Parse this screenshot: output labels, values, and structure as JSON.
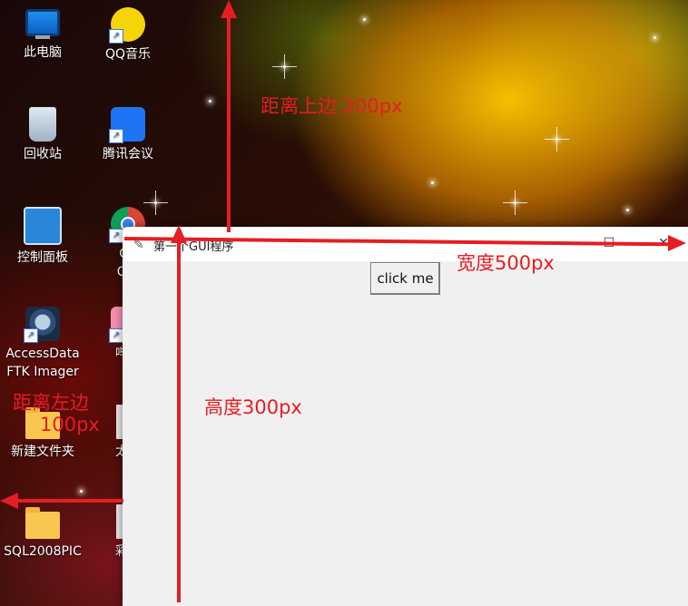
{
  "desktop": {
    "icons": [
      {
        "label": "此电脑",
        "icon": "computer-icon"
      },
      {
        "label": "QQ音乐",
        "icon": "qq-music-icon"
      },
      {
        "label": "回收站",
        "icon": "recycle-bin-icon"
      },
      {
        "label": "腾讯会议",
        "icon": "tencent-meeting-icon"
      },
      {
        "label": "控制面板",
        "icon": "control-panel-icon"
      },
      {
        "label": "Go",
        "label2": "Chr",
        "icon": "chrome-icon"
      },
      {
        "label": "AccessData",
        "label2": "FTK Imager",
        "icon": "ftk-imager-icon"
      },
      {
        "label": "哔哩",
        "icon": "bilibili-icon"
      },
      {
        "label": "新建文件夹",
        "icon": "folder-icon"
      },
      {
        "label": "太阳",
        "icon": "file-icon"
      },
      {
        "label": "SQL2008PIC",
        "icon": "folder-icon"
      },
      {
        "label": "彩旗",
        "icon": "file-icon"
      }
    ]
  },
  "window": {
    "title": "第一个GUI程序",
    "minimize": "—",
    "maximize": "☐",
    "close": "✕",
    "button_label": "click me"
  },
  "annotations": {
    "top": "距离上边 200px",
    "width": "宽度500px",
    "height": "高度300px",
    "left_line1": "距离左边",
    "left_line2": "100px",
    "color": "#e41e24"
  }
}
